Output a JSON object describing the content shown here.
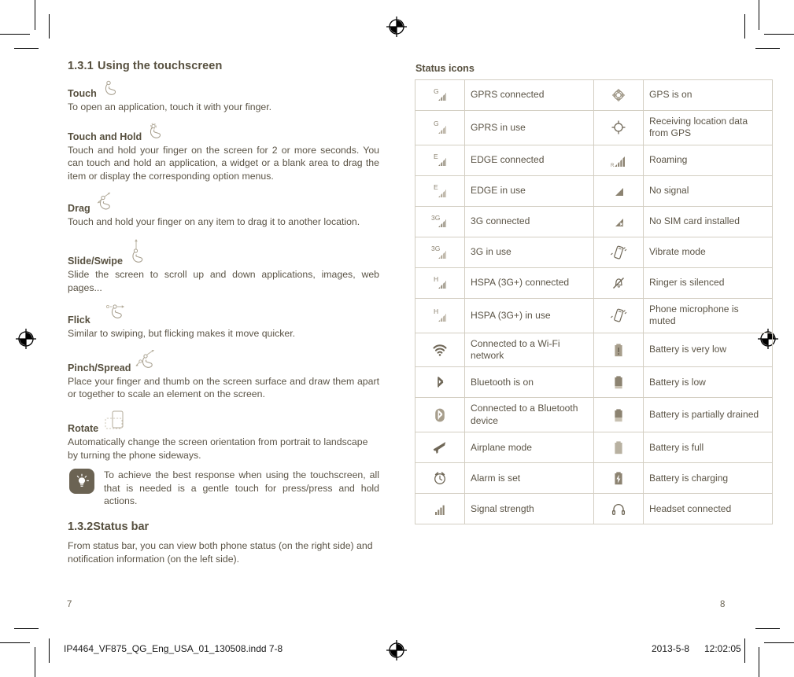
{
  "document": {
    "left_page_number": "7",
    "right_page_number": "8",
    "footer_filename": "IP4464_VF875_QG_Eng_USA_01_130508.indd   7-8",
    "footer_date": "2013-5-8",
    "footer_time": "12:02:05"
  },
  "colors": {
    "text": "#5b5446",
    "heading": "#57503f",
    "icon": "#6f6757",
    "table_border": "#d3cec2",
    "note_badge": "#6b6353"
  },
  "left": {
    "section_number": "1.3.1",
    "section_title": "Using the touchscreen",
    "gestures": [
      {
        "name": "Touch",
        "icon": "touch-hand-icon",
        "text": "To open an application, touch it with your finger."
      },
      {
        "name": "Touch and Hold",
        "icon": "touch-hold-hand-icon",
        "text": "Touch and hold your finger on the screen for 2 or more seconds. You can touch and hold an application, a widget or a blank area to drag the item or display the corresponding option menus."
      },
      {
        "name": "Drag",
        "icon": "drag-hand-icon",
        "text": "Touch and hold your finger on any item to drag it to another location."
      },
      {
        "name": "Slide/Swipe",
        "icon": "slide-hand-icon",
        "text": "Slide the screen to scroll up and down applications, images, web pages..."
      },
      {
        "name": "Flick",
        "icon": "flick-hand-icon",
        "text": "Similar to swiping, but flicking makes it move quicker."
      },
      {
        "name": "Pinch/Spread",
        "icon": "pinch-spread-hand-icon",
        "text": "Place your finger and thumb on the screen surface and draw them apart or together to scale an element on the screen."
      },
      {
        "name": "Rotate",
        "icon": "rotate-phone-icon",
        "text": "Automatically change the screen orientation from portrait to landscape by turning the phone sideways."
      }
    ],
    "note": {
      "icon": "lightbulb-tip-icon",
      "text": "To achieve the best response when using the touchscreen, all that is needed is a gentle touch for press/press and hold actions."
    },
    "section2_number": "1.3.2",
    "section2_title": "Status bar",
    "section2_text": "From status bar, you can view both phone status (on the right side) and notification information (on the left side)."
  },
  "right": {
    "table_title": "Status icons",
    "rows": [
      {
        "left": {
          "icon": "gprs-connected-icon",
          "label": "GPRS connected"
        },
        "right": {
          "icon": "gps-on-icon",
          "label": "GPS is on"
        }
      },
      {
        "left": {
          "icon": "gprs-in-use-icon",
          "label": "GPRS in use"
        },
        "right": {
          "icon": "gps-receiving-icon",
          "label": "Receiving location data from GPS"
        }
      },
      {
        "left": {
          "icon": "edge-connected-icon",
          "label": "EDGE connected"
        },
        "right": {
          "icon": "roaming-icon",
          "label": "Roaming"
        }
      },
      {
        "left": {
          "icon": "edge-in-use-icon",
          "label": "EDGE in use"
        },
        "right": {
          "icon": "no-signal-icon",
          "label": "No signal"
        }
      },
      {
        "left": {
          "icon": "3g-connected-icon",
          "label": "3G connected"
        },
        "right": {
          "icon": "no-sim-card-icon",
          "label": "No SIM card installed"
        }
      },
      {
        "left": {
          "icon": "3g-in-use-icon",
          "label": "3G in use"
        },
        "right": {
          "icon": "vibrate-mode-icon",
          "label": "Vibrate mode"
        }
      },
      {
        "left": {
          "icon": "hspa-connected-icon",
          "label": "HSPA (3G+) connected"
        },
        "right": {
          "icon": "ringer-silenced-icon",
          "label": "Ringer is silenced"
        }
      },
      {
        "left": {
          "icon": "hspa-in-use-icon",
          "label": "HSPA (3G+) in use"
        },
        "right": {
          "icon": "mic-muted-icon",
          "label": "Phone microphone is muted"
        }
      },
      {
        "left": {
          "icon": "wifi-connected-icon",
          "label": "Connected to a Wi-Fi network"
        },
        "right": {
          "icon": "battery-very-low-icon",
          "label": "Battery is very low"
        }
      },
      {
        "left": {
          "icon": "bluetooth-on-icon",
          "label": "Bluetooth is on"
        },
        "right": {
          "icon": "battery-low-icon",
          "label": "Battery is low"
        }
      },
      {
        "left": {
          "icon": "bluetooth-connected-icon",
          "label": "Connected to a Bluetooth device"
        },
        "right": {
          "icon": "battery-partial-icon",
          "label": "Battery is partially drained"
        }
      },
      {
        "left": {
          "icon": "airplane-mode-icon",
          "label": "Airplane mode"
        },
        "right": {
          "icon": "battery-full-icon",
          "label": "Battery is full"
        }
      },
      {
        "left": {
          "icon": "alarm-set-icon",
          "label": "Alarm is set"
        },
        "right": {
          "icon": "battery-charging-icon",
          "label": "Battery is charging"
        }
      },
      {
        "left": {
          "icon": "signal-strength-icon",
          "label": "Signal strength"
        },
        "right": {
          "icon": "headset-connected-icon",
          "label": "Headset connected"
        }
      }
    ]
  }
}
